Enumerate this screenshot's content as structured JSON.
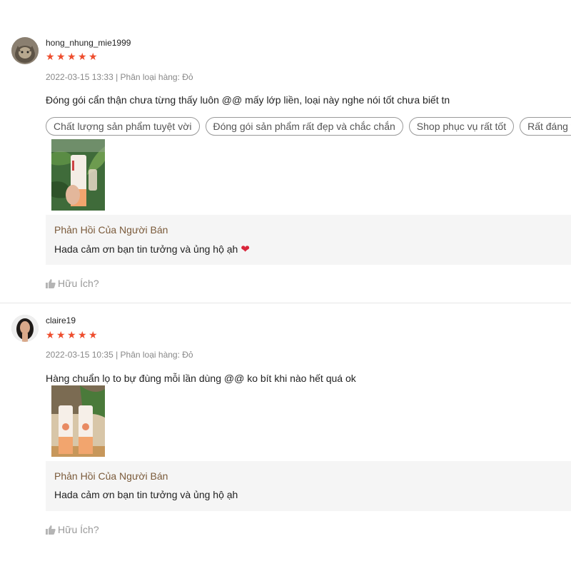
{
  "reviews": [
    {
      "username": "hong_nhung_mie1999",
      "stars": [
        "★",
        "★",
        "★",
        "★",
        "★"
      ],
      "rating": 5,
      "meta": "2022-03-15 13:33 | Phân loại hàng: Đỏ",
      "content": "Đóng gói cẩn thận chưa từng thấy luôn @@ mấy lớp liền, loại này nghe nói tốt chưa biết tn",
      "tags": [
        "Chất lượng sản phẩm tuyệt vời",
        "Đóng gói sản phẩm rất đẹp và chắc chắn",
        "Shop phục vụ rất tốt",
        "Rất đáng tiền"
      ],
      "reply_title": "Phản Hồi Của Người Bán",
      "reply_text": "Hada cảm ơn bạn tin tưởng và ủng hộ ạh",
      "reply_emoji": "❤",
      "helpful": "Hữu Ích?"
    },
    {
      "username": "claire19",
      "stars": [
        "★",
        "★",
        "★",
        "★",
        "★"
      ],
      "rating": 5,
      "meta": "2022-03-15 10:35 | Phân loại hàng: Đỏ",
      "content": "Hàng chuẩn lọ to bự đùng mỗi lần dùng @@ ko bít khi nào hết quá ok",
      "reply_title": "Phản Hồi Của Người Bán",
      "reply_text": "Hada cảm ơn bạn tin tưởng và ủng hộ ạh",
      "helpful": "Hữu Ích?"
    }
  ],
  "colors": {
    "star": "#ee4d2d",
    "reply_title": "#7a5a3a",
    "reply_bg": "#f5f5f5",
    "heart": "#d9263b"
  }
}
